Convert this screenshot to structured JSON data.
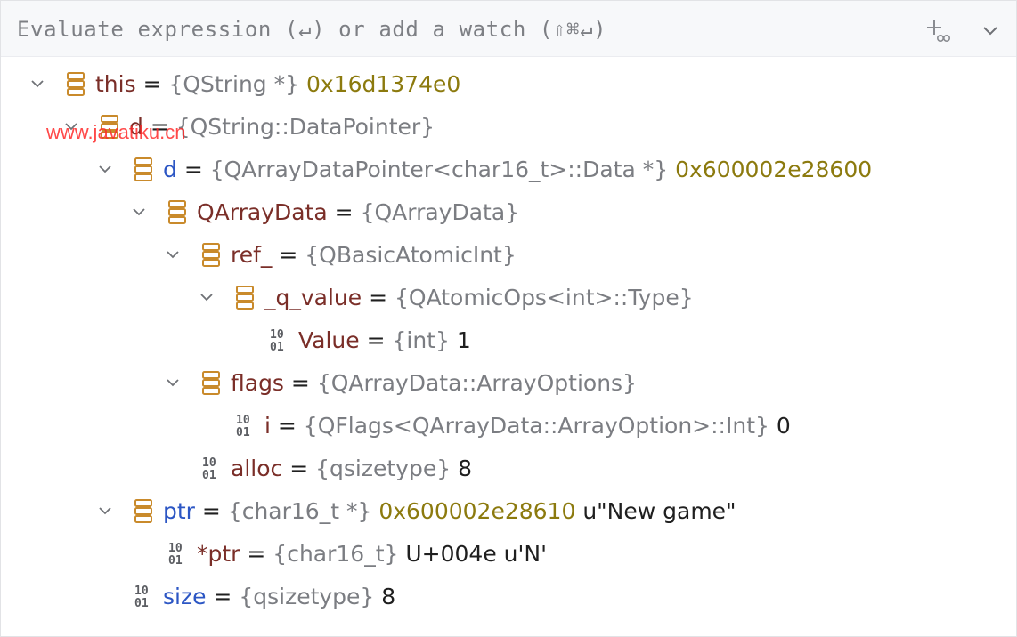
{
  "header": {
    "placeholder": "Evaluate expression (↵) or add a watch (⇧⌘↵)",
    "add_watch_icon": "add-watch-icon",
    "menu_icon": "chevron-down-icon"
  },
  "watermark": "www.javatiku.cn",
  "colors": {
    "name_red": "#7a2e28",
    "name_blue": "#2c56c4",
    "type_gray": "#7b7d82",
    "address": "#8c7a0e",
    "struct_icon": "#c98a2b"
  },
  "tree": [
    {
      "name": "this",
      "name_color": "red",
      "type": "{QString *}",
      "value": "0x16d1374e0",
      "value_kind": "addr",
      "icon": "struct"
    },
    {
      "name": "d",
      "name_color": "red",
      "type": "{QString::DataPointer}",
      "value": "",
      "value_kind": "",
      "icon": "struct"
    },
    {
      "name": "d",
      "name_color": "blue",
      "type": "{QArrayDataPointer<char16_t>::Data *}",
      "value": "0x600002e28600",
      "value_kind": "addr",
      "icon": "struct"
    },
    {
      "name": "QArrayData",
      "name_color": "red",
      "type": "{QArrayData}",
      "value": "",
      "value_kind": "",
      "icon": "struct"
    },
    {
      "name": "ref_",
      "name_color": "red",
      "type": "{QBasicAtomicInt}",
      "value": "",
      "value_kind": "",
      "icon": "struct"
    },
    {
      "name": "_q_value",
      "name_color": "red",
      "type": "{QAtomicOps<int>::Type}",
      "value": "",
      "value_kind": "",
      "icon": "struct"
    },
    {
      "name": "Value",
      "name_color": "red",
      "type": "{int}",
      "value": "1",
      "value_kind": "val",
      "icon": "primitive"
    },
    {
      "name": "flags",
      "name_color": "red",
      "type": "{QArrayData::ArrayOptions}",
      "value": "",
      "value_kind": "",
      "icon": "struct"
    },
    {
      "name": "i",
      "name_color": "red",
      "type": "{QFlags<QArrayData::ArrayOption>::Int}",
      "value": "0",
      "value_kind": "val",
      "icon": "primitive"
    },
    {
      "name": "alloc",
      "name_color": "red",
      "type": "{qsizetype}",
      "value": "8",
      "value_kind": "val",
      "icon": "primitive"
    },
    {
      "name": "ptr",
      "name_color": "blue",
      "type": "{char16_t *}",
      "value": "0x600002e28610",
      "value_kind": "addr",
      "suffix": "u\"New game\"",
      "icon": "struct"
    },
    {
      "name": "*ptr",
      "name_color": "red",
      "type": "{char16_t}",
      "value": "U+004e u'N'",
      "value_kind": "val",
      "icon": "primitive"
    },
    {
      "name": "size",
      "name_color": "blue",
      "type": "{qsizetype}",
      "value": "8",
      "value_kind": "val",
      "icon": "primitive"
    }
  ]
}
